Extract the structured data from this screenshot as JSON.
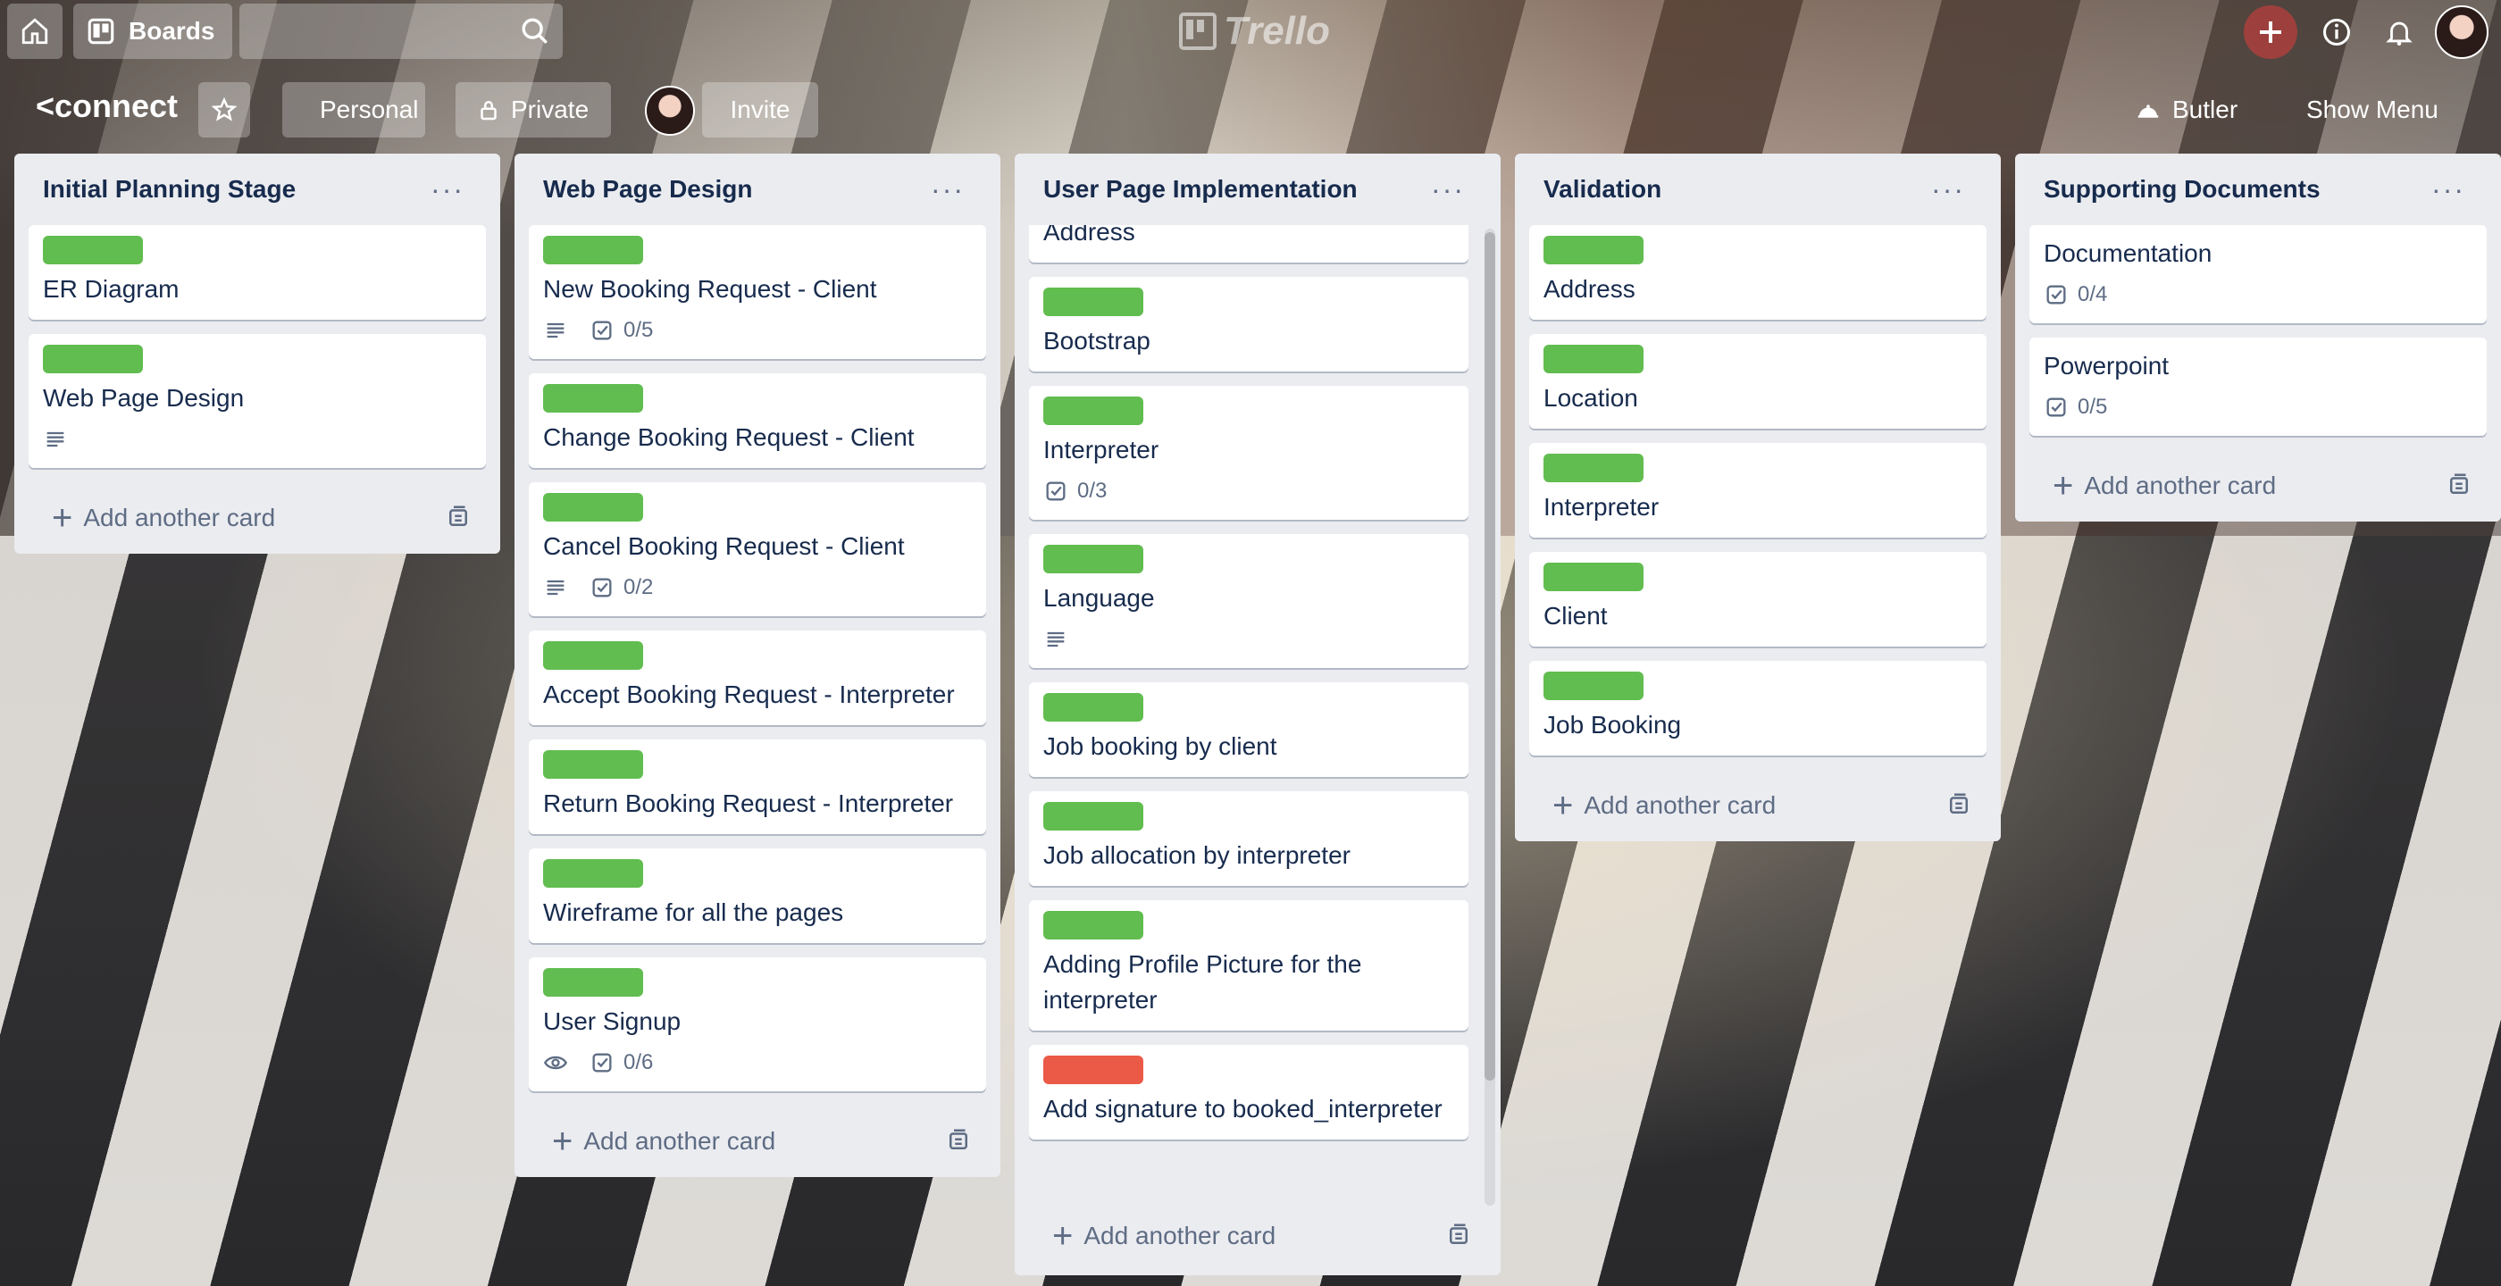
{
  "header": {
    "boards_label": "Boards",
    "logo_text": "Trello"
  },
  "board": {
    "title": "<connect",
    "team_label": "Personal",
    "visibility_label": "Private",
    "invite_label": "Invite",
    "butler_label": "Butler",
    "show_menu_label": "Show Menu"
  },
  "colors": {
    "label_green": "#61bd4f",
    "label_red": "#eb5a46",
    "list_bg": "#ebecf0"
  },
  "lists": [
    {
      "title": "Initial Planning Stage",
      "add_label": "Add another card",
      "cards": [
        {
          "title": "ER Diagram",
          "label": "green"
        },
        {
          "title": "Web Page Design",
          "label": "green",
          "description": true
        }
      ]
    },
    {
      "title": "Web Page Design",
      "add_label": "Add another card",
      "cards": [
        {
          "title": "New Booking Request - Client",
          "label": "green",
          "description": true,
          "checklist": "0/5"
        },
        {
          "title": "Change Booking Request - Client",
          "label": "green"
        },
        {
          "title": "Cancel Booking Request - Client",
          "label": "green",
          "description": true,
          "checklist": "0/2"
        },
        {
          "title": "Accept Booking Request - Interpreter",
          "label": "green"
        },
        {
          "title": "Return Booking Request - Interpreter",
          "label": "green"
        },
        {
          "title": "Wireframe for all the pages",
          "label": "green"
        },
        {
          "title": "User Signup",
          "label": "green",
          "watch": true,
          "checklist": "0/6"
        }
      ]
    },
    {
      "title": "User Page Implementation",
      "add_label": "Add another card",
      "cards": [
        {
          "title": "Address"
        },
        {
          "title": "Bootstrap",
          "label": "green"
        },
        {
          "title": "Interpreter",
          "label": "green",
          "checklist": "0/3"
        },
        {
          "title": "Language",
          "label": "green",
          "description": true
        },
        {
          "title": "Job booking by client",
          "label": "green"
        },
        {
          "title": "Job allocation by interpreter",
          "label": "green"
        },
        {
          "title": "Adding Profile Picture for the interpreter",
          "label": "green"
        },
        {
          "title": "Add signature to booked_interpreter",
          "label": "red"
        }
      ]
    },
    {
      "title": "Validation",
      "add_label": "Add another card",
      "cards": [
        {
          "title": "Address",
          "label": "green"
        },
        {
          "title": "Location",
          "label": "green"
        },
        {
          "title": "Interpreter",
          "label": "green"
        },
        {
          "title": "Client",
          "label": "green"
        },
        {
          "title": "Job Booking",
          "label": "green"
        }
      ]
    },
    {
      "title": "Supporting Documents",
      "add_label": "Add another card",
      "cards": [
        {
          "title": "Documentation",
          "checklist": "0/4"
        },
        {
          "title": "Powerpoint",
          "checklist": "0/5"
        }
      ]
    }
  ]
}
